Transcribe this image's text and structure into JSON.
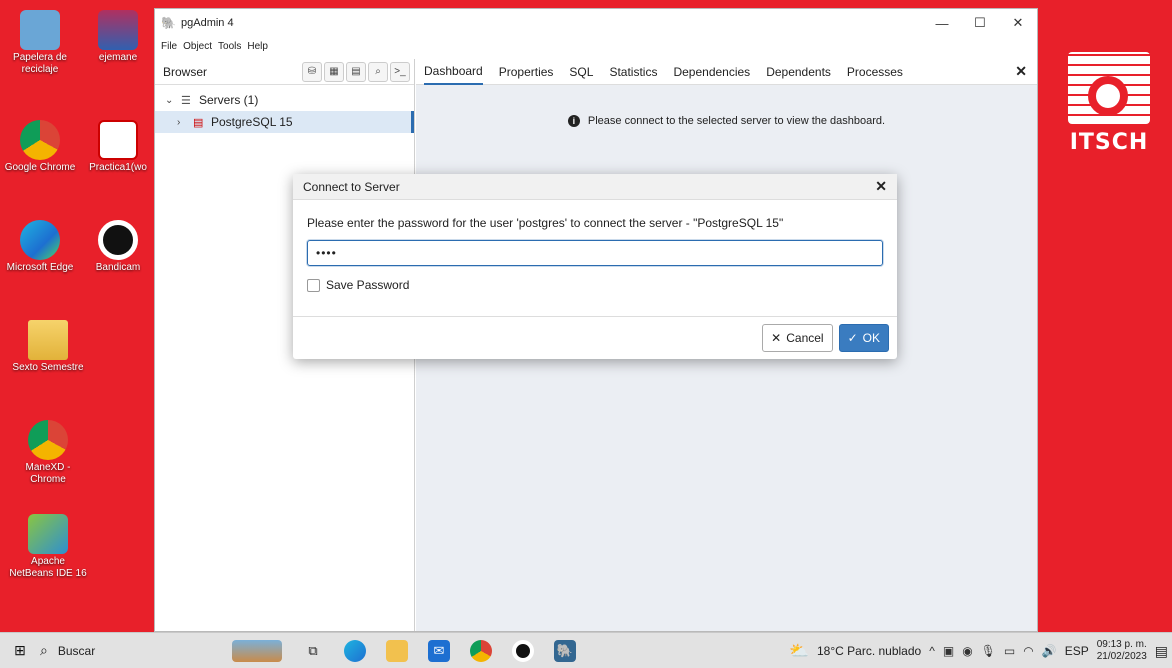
{
  "desktop": {
    "icons": [
      {
        "label": "Papelera de reciclaje"
      },
      {
        "label": "ejemane"
      },
      {
        "label": "Google Chrome"
      },
      {
        "label": "Practica1(wo"
      },
      {
        "label": "Microsoft Edge"
      },
      {
        "label": "Bandicam"
      },
      {
        "label": "Sexto Semestre"
      },
      {
        "label": "ManeXD - Chrome"
      },
      {
        "label": "Apache NetBeans IDE 16"
      }
    ],
    "logo_text": "ITSCH"
  },
  "window": {
    "title": "pgAdmin 4",
    "menu": [
      "File",
      "Object",
      "Tools",
      "Help"
    ]
  },
  "browser": {
    "title": "Browser",
    "tree": [
      {
        "label": "Servers (1)"
      },
      {
        "label": "PostgreSQL 15"
      }
    ]
  },
  "tabs": [
    "Dashboard",
    "Properties",
    "SQL",
    "Statistics",
    "Dependencies",
    "Dependents",
    "Processes"
  ],
  "dashboard": {
    "message": "Please connect to the selected server to view the dashboard."
  },
  "dialog": {
    "title": "Connect to Server",
    "prompt": "Please enter the password for the user 'postgres' to connect the server - \"PostgreSQL 15\"",
    "password_value": "••••",
    "save_password_label": "Save Password",
    "save_password_checked": false,
    "cancel_label": "Cancel",
    "ok_label": "OK"
  },
  "taskbar": {
    "search_label": "Buscar",
    "weather": "18°C Parc. nublado",
    "language": "ESP",
    "time": "09:13 p. m.",
    "date": "21/02/2023"
  },
  "colors": {
    "desktop_bg": "#e8202a",
    "accent": "#2b6cb0",
    "ok_button": "#3a7cc0"
  }
}
